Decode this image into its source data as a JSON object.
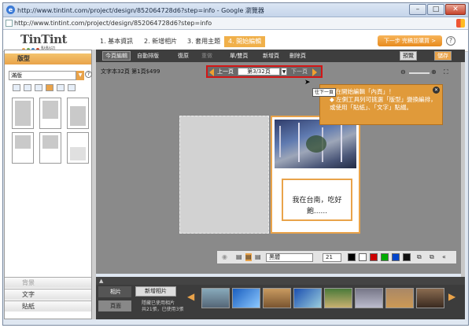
{
  "window": {
    "title": "http://www.tintint.com/project/design/852064728d6?step=info - Google 瀏覽器",
    "url": "http://www.tintint.com/project/design/852064728d6?step=info"
  },
  "brand": {
    "name": "TinTint",
    "sub": "點點印",
    "accent": "#e9a34a",
    "dot_colors": [
      "#e9a34a",
      "#6aa84f",
      "#3d85c6",
      "#cc4125"
    ]
  },
  "steps": [
    {
      "label": "1. 基本資訊"
    },
    {
      "label": "2. 新增相片"
    },
    {
      "label": "3. 套用主題"
    },
    {
      "label": "4. 開始編輯"
    }
  ],
  "next_button": "下一步 完稿並購買 >",
  "left_panel": {
    "tab": "版型",
    "select_value": "滿版",
    "bottom": [
      {
        "label": "背景"
      },
      {
        "label": "文字"
      },
      {
        "label": "貼紙"
      }
    ]
  },
  "toolbar": {
    "items": [
      {
        "label": "今頁編輯"
      },
      {
        "label": "自動排版"
      },
      {
        "label": "復原"
      },
      {
        "label": "重做"
      },
      {
        "label": "單/雙頁"
      },
      {
        "label": "新增頁"
      },
      {
        "label": "刪除頁"
      }
    ],
    "preview": "預覽",
    "save": "儲存"
  },
  "canvas": {
    "info": "文字本32頁 第1頁$499",
    "page_prev": "上一頁",
    "page_select": "第3/32頁",
    "page_next": "下一頁",
    "caption": "我在台南，吃好飽......",
    "tooltip_label": "往下一頁",
    "tooltip_text": "現在開始編輯「內頁」！\n◆ 左側工具列可挑選「版型」變換編排，或使用「貼紙」、「文字」點綴。"
  },
  "text_tools": {
    "font": "黑體",
    "size": "21",
    "colors": [
      "#000000",
      "#ffffff",
      "#cc0000",
      "#00aa00",
      "#0044cc",
      "#111111"
    ]
  },
  "tray": {
    "tabs": [
      {
        "label": "相片"
      },
      {
        "label": "頁面"
      }
    ],
    "add_photo": "新增相片",
    "note": "隱藏已使用相片\n共21張，已使用3張"
  },
  "icons": [
    "ie-icon",
    "minimize-icon",
    "maximize-icon",
    "close-icon",
    "help-icon",
    "prev-arrow-icon",
    "next-arrow-icon",
    "zoom-out-icon",
    "zoom-in-icon",
    "fullscreen-icon"
  ]
}
